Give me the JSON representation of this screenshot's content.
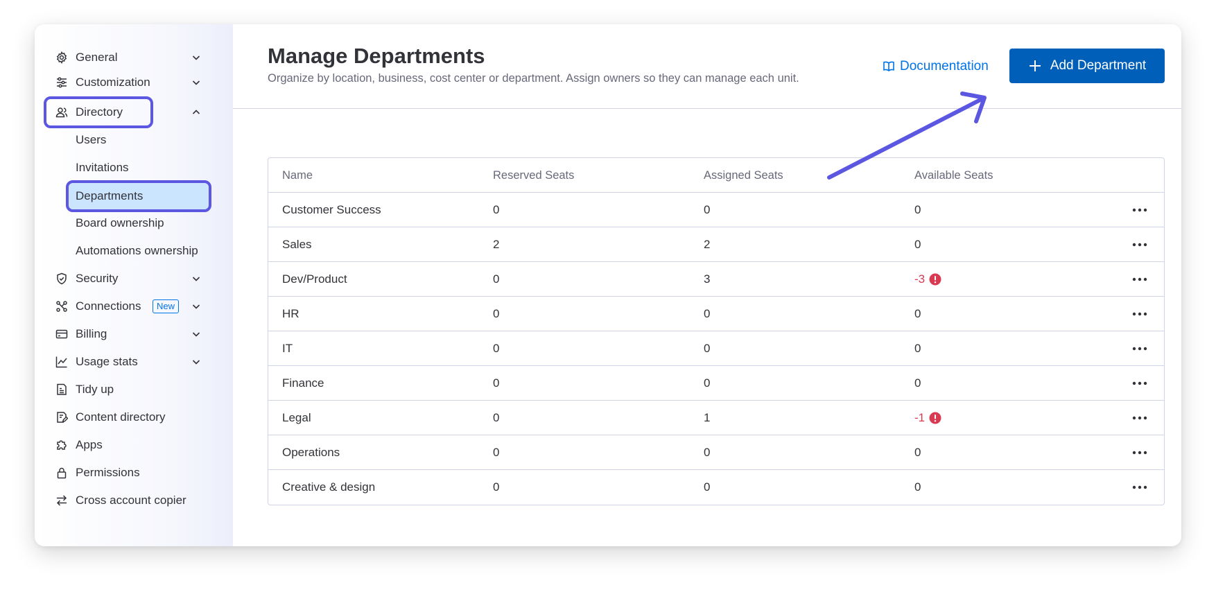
{
  "sidebar": {
    "items": [
      {
        "label": "General",
        "icon": "gear-icon"
      },
      {
        "label": "Customization",
        "icon": "sliders-icon"
      },
      {
        "label": "Directory",
        "icon": "users-icon"
      },
      {
        "label": "Security",
        "icon": "shield-icon"
      },
      {
        "label": "Connections",
        "icon": "connections-icon",
        "badge": "New"
      },
      {
        "label": "Billing",
        "icon": "credit-card-icon"
      },
      {
        "label": "Usage stats",
        "icon": "chart-icon"
      },
      {
        "label": "Tidy up",
        "icon": "broom-icon"
      },
      {
        "label": "Content directory",
        "icon": "document-icon"
      },
      {
        "label": "Apps",
        "icon": "puzzle-icon"
      },
      {
        "label": "Permissions",
        "icon": "lock-icon"
      },
      {
        "label": "Cross account copier",
        "icon": "swap-icon"
      }
    ],
    "directory_subitems": [
      "Users",
      "Invitations",
      "Departments",
      "Board ownership",
      "Automations ownership"
    ]
  },
  "header": {
    "title": "Manage Departments",
    "subtitle": "Organize by location, business, cost center or department. Assign owners so they can manage each unit.",
    "documentation_label": "Documentation",
    "add_button_label": "Add Department"
  },
  "table": {
    "columns": [
      "Name",
      "Reserved Seats",
      "Assigned Seats",
      "Available Seats"
    ],
    "rows": [
      {
        "name": "Customer Success",
        "reserved": "0",
        "assigned": "0",
        "available": "0",
        "warning": false
      },
      {
        "name": "Sales",
        "reserved": "2",
        "assigned": "2",
        "available": "0",
        "warning": false
      },
      {
        "name": "Dev/Product",
        "reserved": "0",
        "assigned": "3",
        "available": "-3",
        "warning": true
      },
      {
        "name": "HR",
        "reserved": "0",
        "assigned": "0",
        "available": "0",
        "warning": false
      },
      {
        "name": "IT",
        "reserved": "0",
        "assigned": "0",
        "available": "0",
        "warning": false
      },
      {
        "name": "Finance",
        "reserved": "0",
        "assigned": "0",
        "available": "0",
        "warning": false
      },
      {
        "name": "Legal",
        "reserved": "0",
        "assigned": "1",
        "available": "-1",
        "warning": true
      },
      {
        "name": "Operations",
        "reserved": "0",
        "assigned": "0",
        "available": "0",
        "warning": false
      },
      {
        "name": "Creative & design",
        "reserved": "0",
        "assigned": "0",
        "available": "0",
        "warning": false
      }
    ]
  },
  "colors": {
    "accent": "#0073ea",
    "primary_button": "#0060b9",
    "highlight": "#5b57e0",
    "warning": "#d83a52"
  }
}
